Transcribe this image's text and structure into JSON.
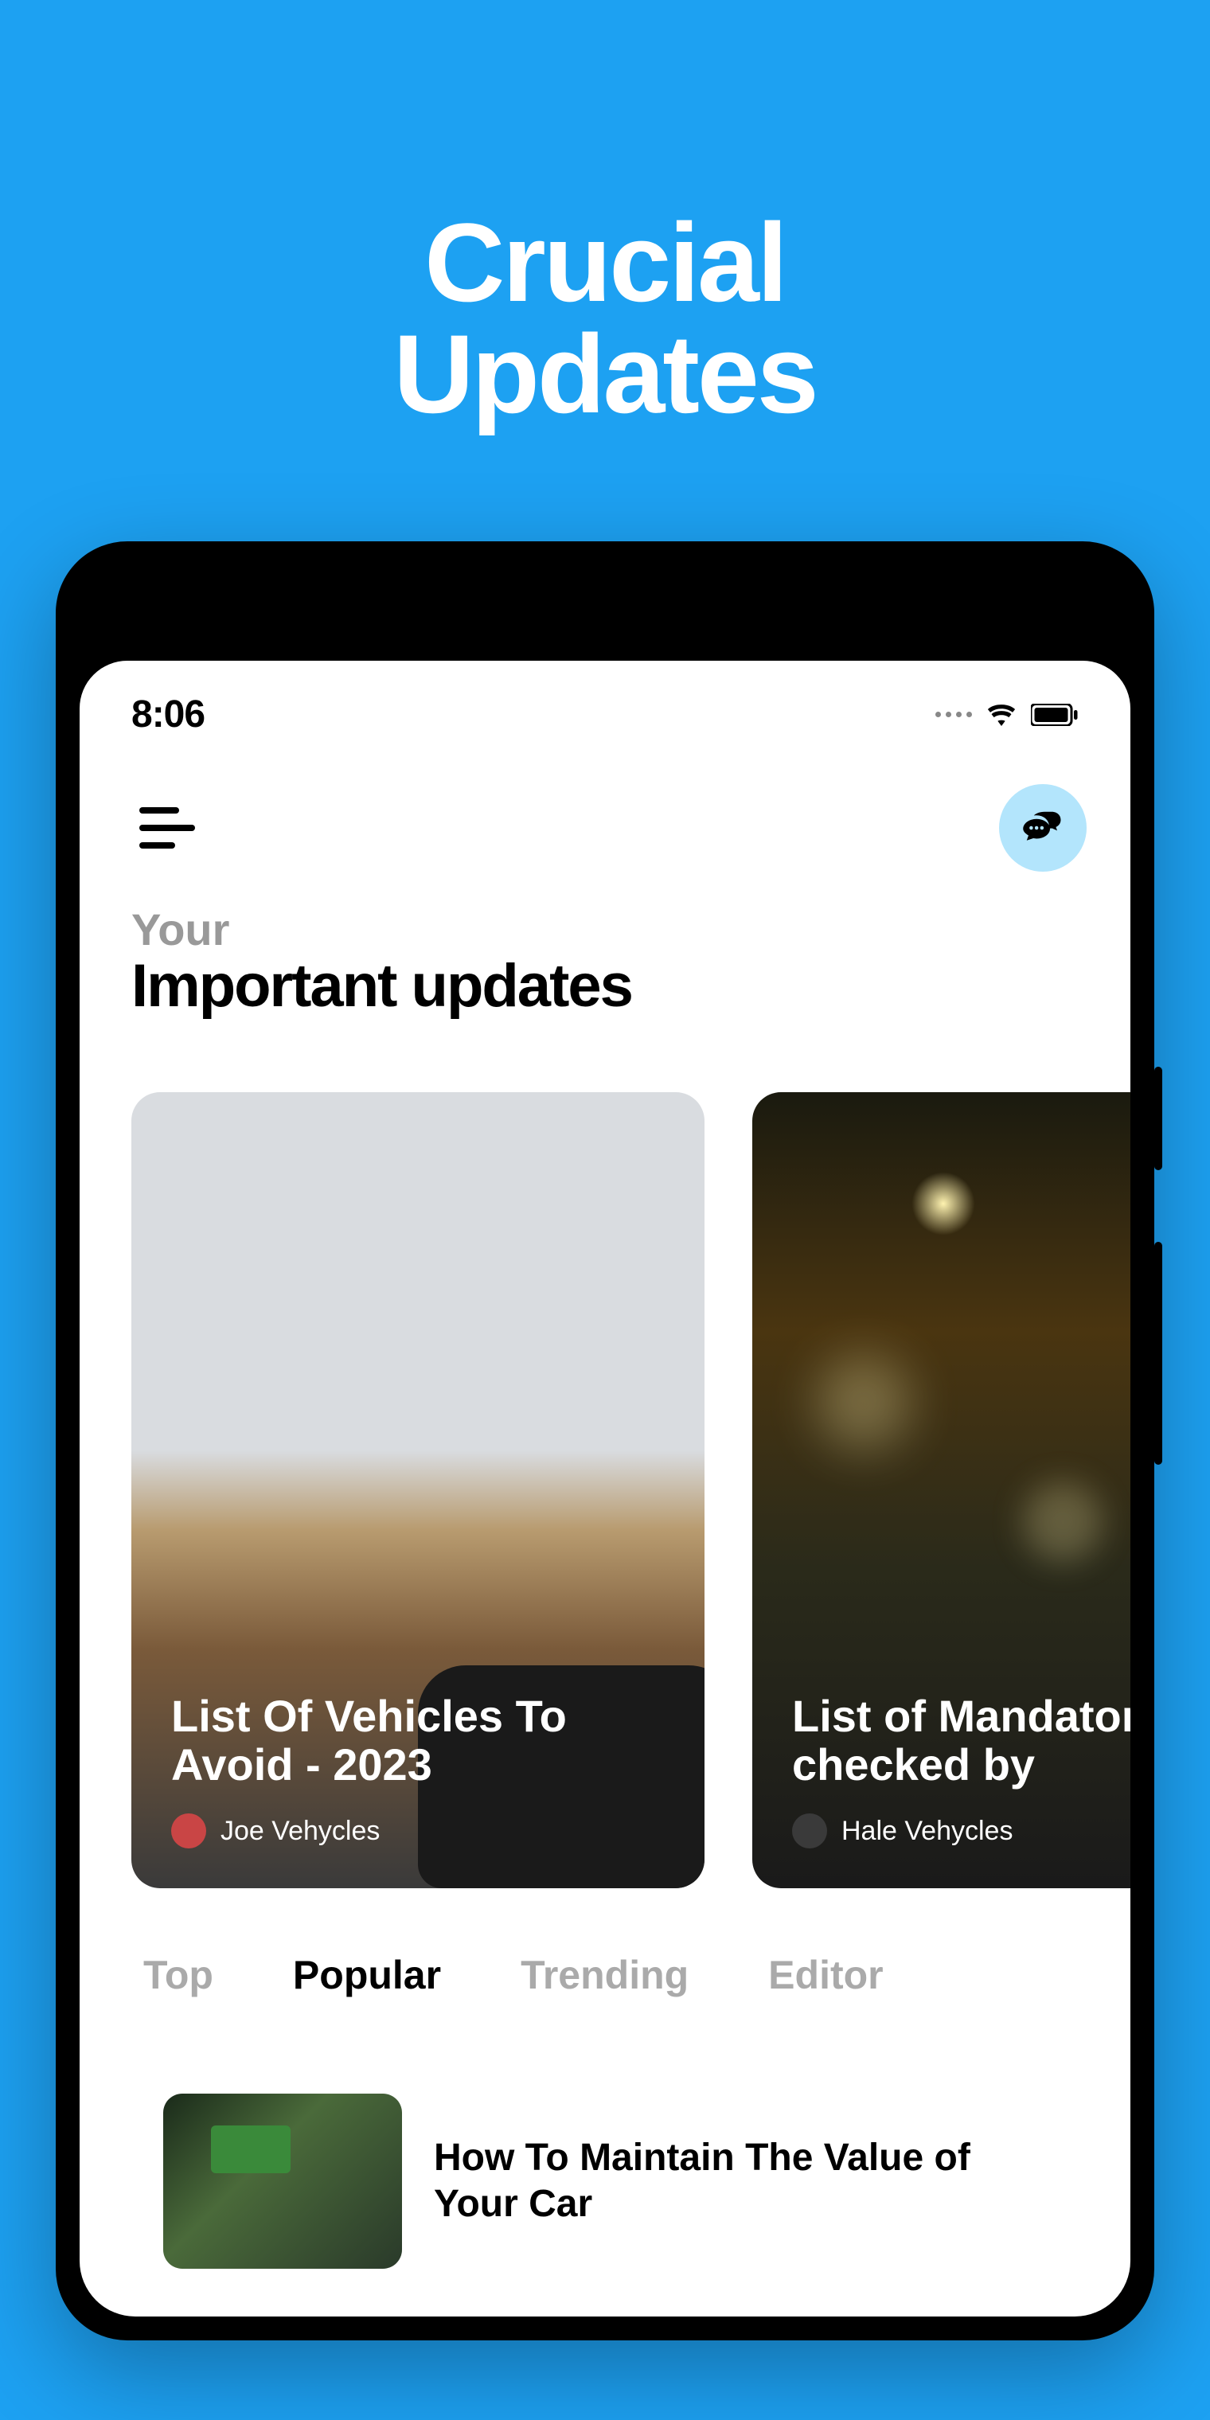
{
  "hero": "Crucial\nUpdates",
  "status": {
    "time": "8:06"
  },
  "heading": {
    "small": "Your",
    "large": "Important updates"
  },
  "cards": [
    {
      "title": "List Of Vehicles To Avoid - 2023",
      "author": "Joe Vehycles"
    },
    {
      "title": "List of Mandatory It checked by",
      "author": "Hale Vehycles"
    }
  ],
  "tabs": [
    {
      "label": "Top",
      "active": false
    },
    {
      "label": "Popular",
      "active": true
    },
    {
      "label": "Trending",
      "active": false
    },
    {
      "label": "Editor",
      "active": false
    }
  ],
  "list": [
    {
      "title": "How To Maintain The Value of Your Car"
    }
  ]
}
